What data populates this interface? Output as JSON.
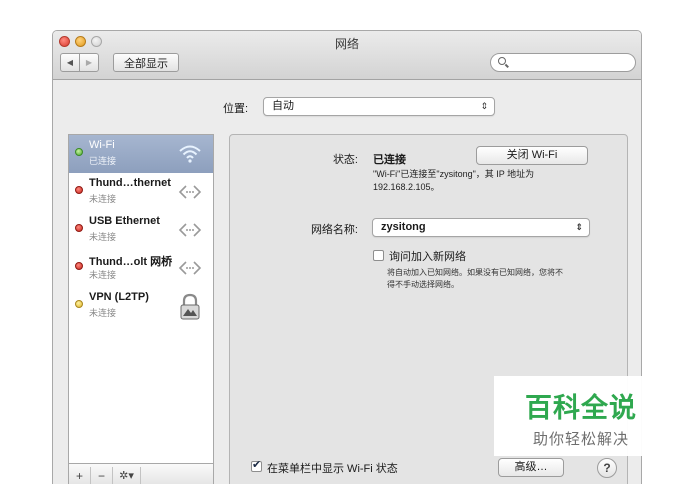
{
  "window": {
    "title": "网络",
    "show_all": "全部显示",
    "nav_back": "◀",
    "nav_forward": "▶",
    "search_placeholder": ""
  },
  "location": {
    "label": "位置:",
    "value": "自动",
    "arrows": "⇕"
  },
  "services": [
    {
      "name": "Wi-Fi",
      "status": "已连接",
      "dot": "green",
      "icon": "wifi-icon",
      "selected": true
    },
    {
      "name": "Thund…thernet",
      "status": "未连接",
      "dot": "red",
      "icon": "ethernet-arrows-icon"
    },
    {
      "name": "USB Ethernet",
      "status": "未连接",
      "dot": "red",
      "icon": "ethernet-arrows-icon"
    },
    {
      "name": "Thund…olt 网桥",
      "status": "未连接",
      "dot": "red",
      "icon": "ethernet-arrows-icon"
    },
    {
      "name": "VPN (L2TP)",
      "status": "未连接",
      "dot": "yellow",
      "icon": "vpn-lock-icon"
    }
  ],
  "sidebar_footer": {
    "add": "+",
    "remove": "−",
    "gear": "✲▾"
  },
  "detail": {
    "status_label": "状态:",
    "status_value": "已连接",
    "turn_off_button": "关闭 Wi-Fi",
    "status_desc_line1": "\"Wi-Fi\"已连接至\"zysitong\"，其 IP 地址为",
    "status_desc_line2": "192.168.2.105。",
    "network_name_label": "网络名称:",
    "network_name_value": "zysitong",
    "ask_join_label": "询问加入新网络",
    "ask_join_desc_line1": "将自动加入已知网络。如果没有已知网络，您将不",
    "ask_join_desc_line2": "得不手动选择网络。",
    "show_in_menubar_label": "在菜单栏中显示 Wi-Fi 状态",
    "show_in_menubar_checked": true,
    "advanced_button": "高级…",
    "help_button": "?"
  },
  "watermark": {
    "title": "百科全说",
    "subtitle": "助你轻松解决"
  },
  "colors": {
    "selected_row": "#9aabc8",
    "watermark_green": "#2fa84f"
  }
}
